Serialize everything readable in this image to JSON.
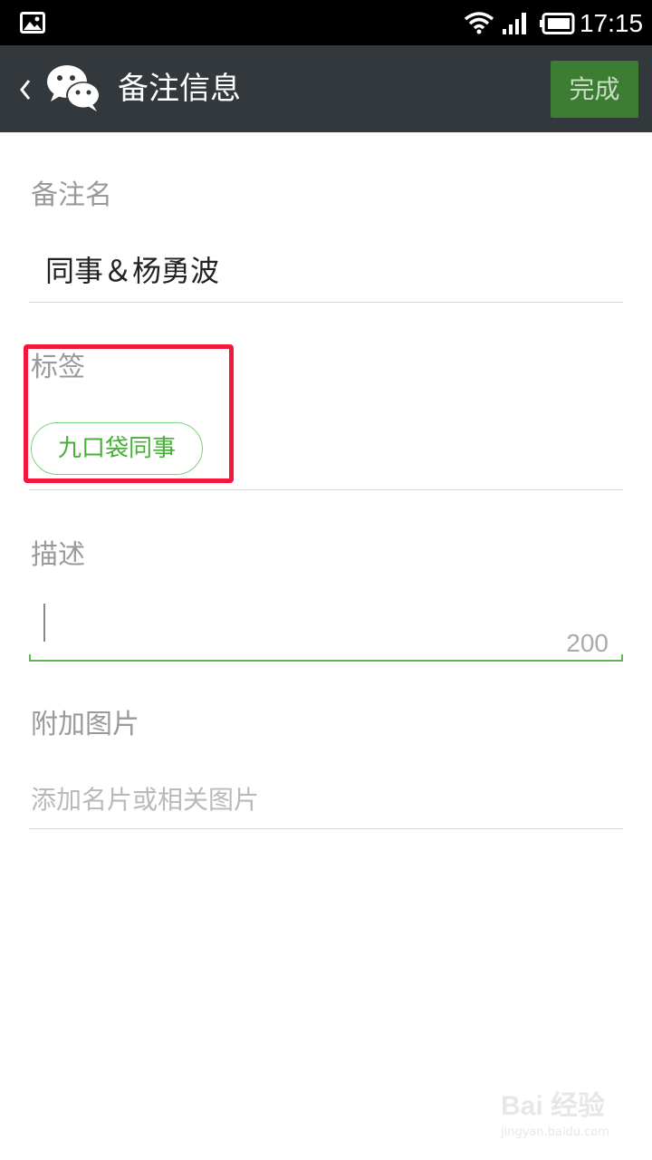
{
  "status_bar": {
    "time": "17:15",
    "icons": [
      "gallery-icon",
      "wifi-icon",
      "signal-icon",
      "battery-icon"
    ]
  },
  "header": {
    "back_icon": "chevron-left-icon",
    "logo_icon": "wechat-icon",
    "title": "备注信息",
    "done_label": "完成"
  },
  "remark_name": {
    "label": "备注名",
    "value": "同事＆杨勇波"
  },
  "tags": {
    "label": "标签",
    "items": [
      "九口袋同事"
    ]
  },
  "description": {
    "label": "描述",
    "value": "",
    "char_count": "200"
  },
  "photos": {
    "label": "附加图片",
    "placeholder": "添加名片或相关图片"
  },
  "watermark": {
    "brand": "Bai 经验",
    "url": "jingyan.baidu.com"
  },
  "colors": {
    "title_bar": "#33383c",
    "done_button": "#3c7d33",
    "accent_green": "#45b035",
    "highlight_red": "#f5163c"
  }
}
